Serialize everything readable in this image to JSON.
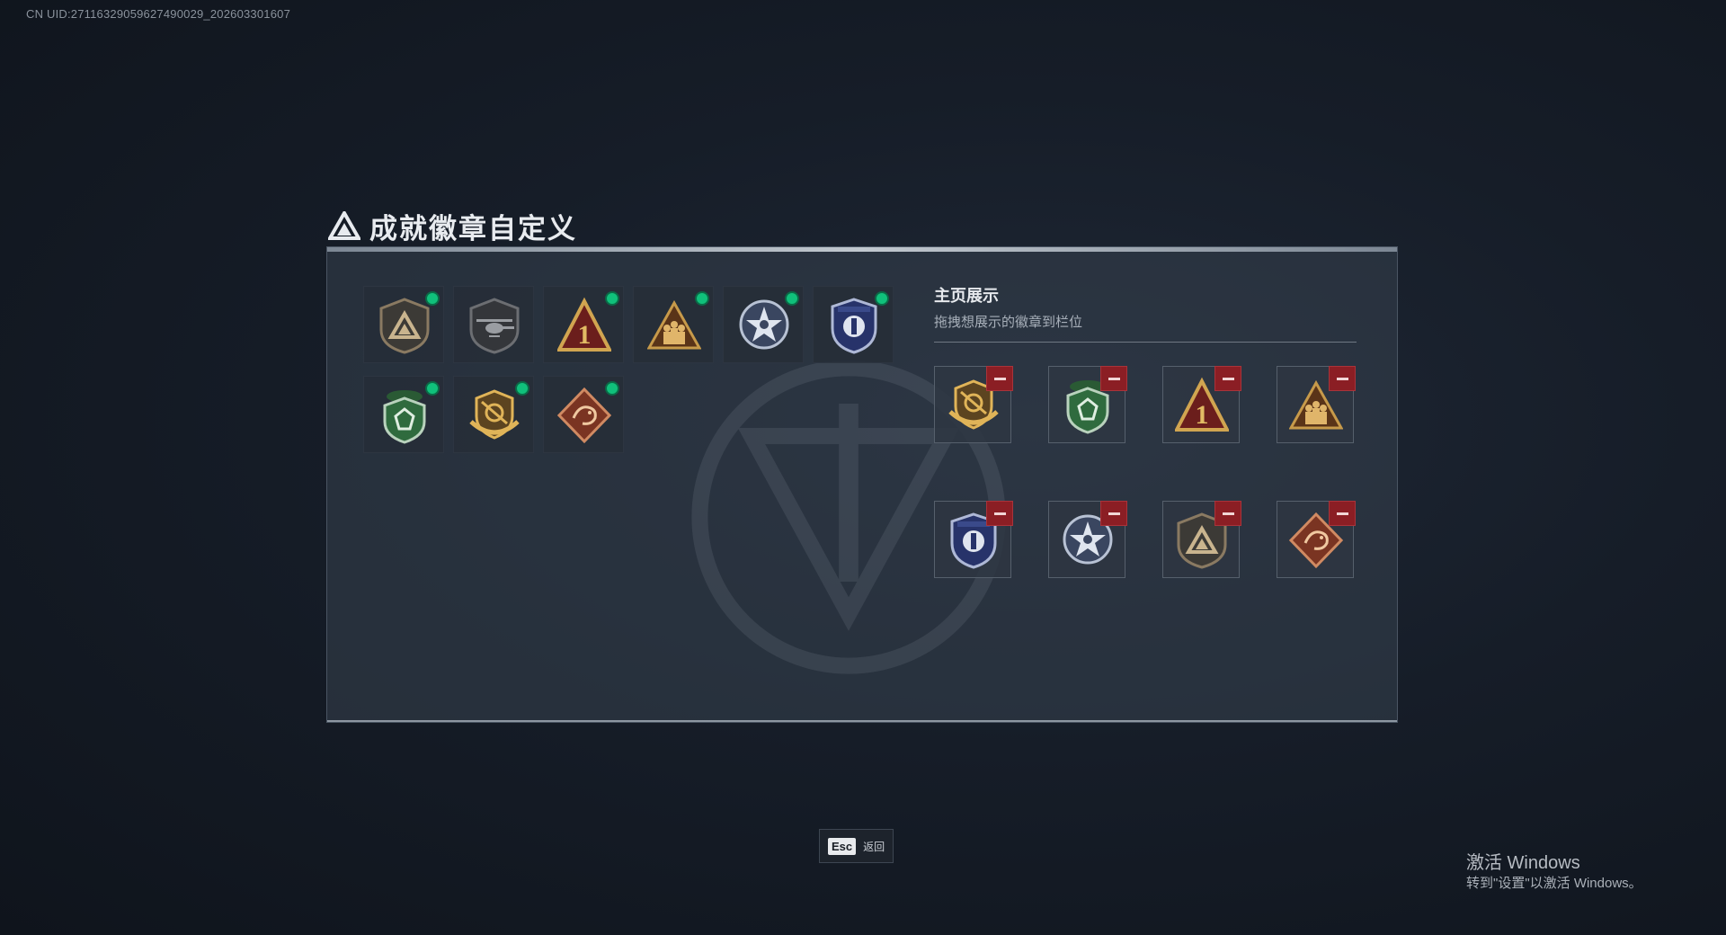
{
  "header": {
    "uid_text": "CN UID:2711632905962749002​9_202603301607",
    "title": "成就徽章自定义"
  },
  "owned_badges": [
    {
      "icon": "triangle-shield-badge-icon",
      "new": true
    },
    {
      "icon": "helicopter-shield-badge-icon",
      "new": false
    },
    {
      "icon": "number-one-triangle-badge-icon",
      "new": true
    },
    {
      "icon": "soldiers-triangle-badge-icon",
      "new": true
    },
    {
      "icon": "silver-star-medal-badge-icon",
      "new": true
    },
    {
      "icon": "blue-police-shield-badge-icon",
      "new": true
    },
    {
      "icon": "green-beret-shield-badge-icon",
      "new": true
    },
    {
      "icon": "gold-wings-emblem-badge-icon",
      "new": true
    },
    {
      "icon": "dragon-diamond-badge-icon",
      "new": true
    }
  ],
  "showcase": {
    "title": "主页展示",
    "subtitle": "拖拽想展示的徽章到栏位",
    "slots": [
      {
        "icon": "gold-wings-emblem-badge-icon"
      },
      {
        "icon": "green-beret-shield-badge-icon"
      },
      {
        "icon": "number-one-triangle-badge-icon"
      },
      {
        "icon": "soldiers-triangle-badge-icon"
      },
      {
        "icon": "blue-police-shield-badge-icon"
      },
      {
        "icon": "silver-star-medal-badge-icon"
      },
      {
        "icon": "triangle-shield-badge-icon"
      },
      {
        "icon": "dragon-diamond-badge-icon"
      }
    ]
  },
  "footer": {
    "esc_key": "Esc",
    "esc_label": "返回"
  },
  "windows_watermark": {
    "title": "激活 Windows",
    "subtitle": "转到\"设置\"以激活 Windows。"
  },
  "colors": {
    "new_dot": "#10c07b",
    "remove_button": "#8b1e24",
    "panel_border": "#4a5563"
  }
}
